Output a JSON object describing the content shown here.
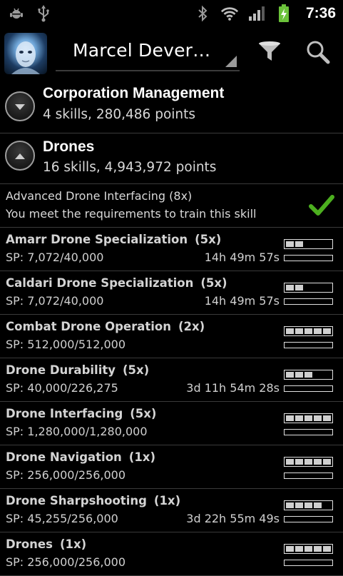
{
  "status_bar": {
    "left_icons": [
      "debug-bug-icon",
      "usb-icon"
    ],
    "right_icons": [
      "bluetooth-icon",
      "wifi-icon",
      "signal-icon",
      "battery-charging-icon"
    ],
    "time": "7:36"
  },
  "action_bar": {
    "character_name": "Marcel Dever…",
    "icons": [
      "avatar",
      "filter-icon",
      "search-icon"
    ]
  },
  "groups": [
    {
      "title": "Corporation Management",
      "subtitle": "4 skills, 280,486 points",
      "expanded": false
    },
    {
      "title": "Drones",
      "subtitle": "16 skills, 4,943,972 points",
      "expanded": true
    }
  ],
  "notice": {
    "title": "Advanced Drone Interfacing  (8x)",
    "message": "You meet the requirements to train this skill",
    "icon": "checkmark-icon"
  },
  "skills": [
    {
      "name": "Amarr Drone Specialization",
      "rank": "(5x)",
      "sp": "SP: 7,072/40,000",
      "time": "14h 49m 57s",
      "level": 2
    },
    {
      "name": "Caldari Drone Specialization",
      "rank": "(5x)",
      "sp": "SP: 7,072/40,000",
      "time": "14h 49m 57s",
      "level": 2
    },
    {
      "name": "Combat Drone Operation",
      "rank": "(2x)",
      "sp": "SP: 512,000/512,000",
      "time": "",
      "level": 5
    },
    {
      "name": "Drone Durability",
      "rank": "(5x)",
      "sp": "SP: 40,000/226,275",
      "time": "3d 11h 54m 28s",
      "level": 3
    },
    {
      "name": "Drone Interfacing",
      "rank": "(5x)",
      "sp": "SP: 1,280,000/1,280,000",
      "time": "",
      "level": 5
    },
    {
      "name": "Drone Navigation",
      "rank": "(1x)",
      "sp": "SP: 256,000/256,000",
      "time": "",
      "level": 5
    },
    {
      "name": "Drone Sharpshooting",
      "rank": "(1x)",
      "sp": "SP: 45,255/256,000",
      "time": "3d 22h 55m 49s",
      "level": 4
    },
    {
      "name": "Drones",
      "rank": "(1x)",
      "sp": "SP: 256,000/256,000",
      "time": "",
      "level": 5
    }
  ],
  "colors": {
    "background": "#000000",
    "divider": "#3a3a3a",
    "check_green": "#4caf1f",
    "battery_green": "#6bc23a"
  }
}
